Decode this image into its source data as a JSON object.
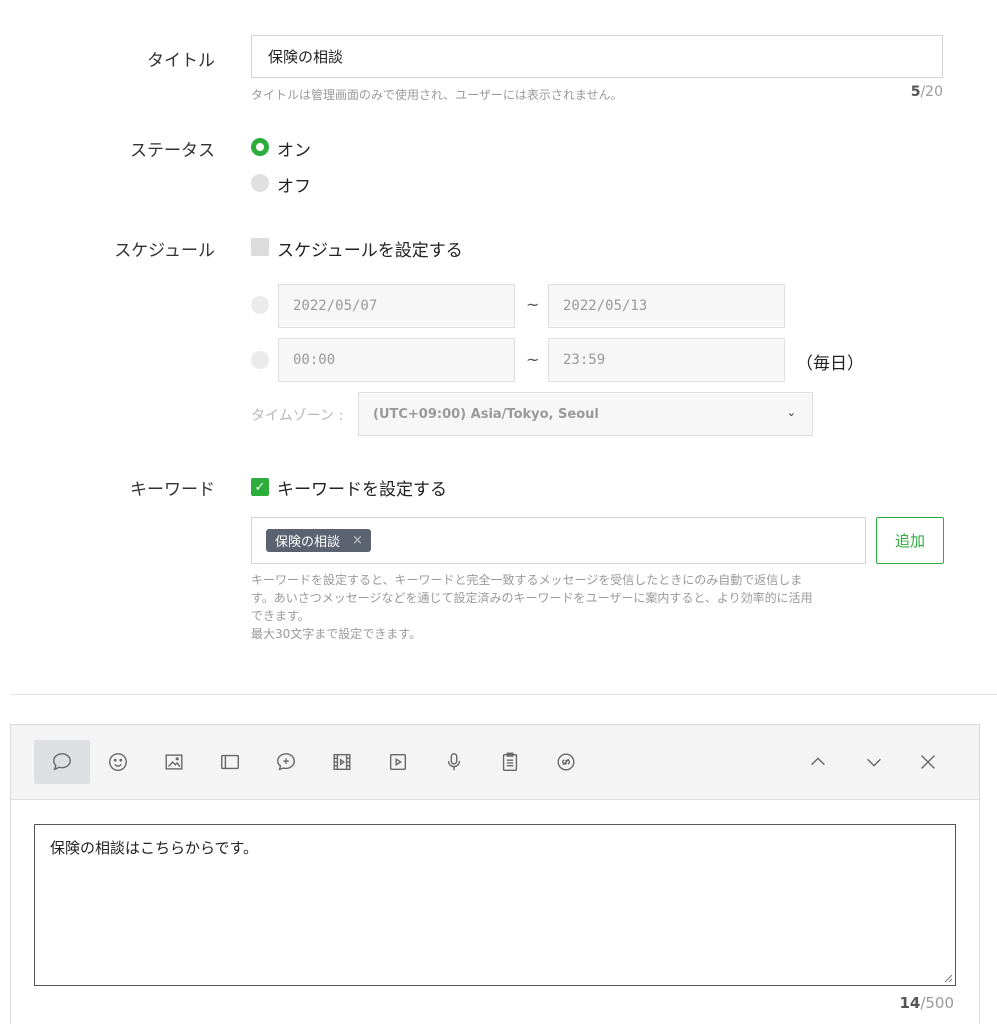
{
  "title_field": {
    "label": "タイトル",
    "value": "保険の相談",
    "hint": "タイトルは管理画面のみで使用され、ユーザーには表示されません。",
    "count": "5",
    "max": "/20"
  },
  "status": {
    "label": "ステータス",
    "options": [
      {
        "label": "オン",
        "selected": true
      },
      {
        "label": "オフ",
        "selected": false
      }
    ]
  },
  "schedule": {
    "label": "スケジュール",
    "checkbox_label": "スケジュールを設定する",
    "checked": false,
    "date_from": "2022/05/07",
    "date_to": "2022/05/13",
    "time_from": "00:00",
    "time_to": "23:59",
    "tilde": "~",
    "daily": "（毎日）",
    "timezone_label": "タイムゾーン :",
    "timezone_value": "(UTC+09:00) Asia/Tokyo, Seoul"
  },
  "keyword": {
    "label": "キーワード",
    "checkbox_label": "キーワードを設定する",
    "checked": true,
    "tags": [
      "保険の相談"
    ],
    "tag_remove": "×",
    "add_button": "追加",
    "hint_lines": [
      "キーワードを設定すると、キーワードと完全一致するメッセージを受信したときにのみ自動で返信しま",
      "す。あいさつメッセージなどを通じて設定済みのキーワードをユーザーに案内すると、より効率的に活用",
      "できます。",
      "最大30文字まで設定できます。"
    ]
  },
  "editor": {
    "toolbar_icons": [
      "speech-bubble-icon",
      "smiley-icon",
      "image-icon",
      "card-icon",
      "coupon-icon",
      "video-icon",
      "play-icon",
      "microphone-icon",
      "clipboard-icon",
      "link-icon"
    ],
    "active_tool": "speech-bubble-icon",
    "message": "保険の相談はこちらからです。",
    "count": "14",
    "max": "/500"
  },
  "colors": {
    "accent": "#2dad3c",
    "tag_bg": "#5b6370"
  }
}
